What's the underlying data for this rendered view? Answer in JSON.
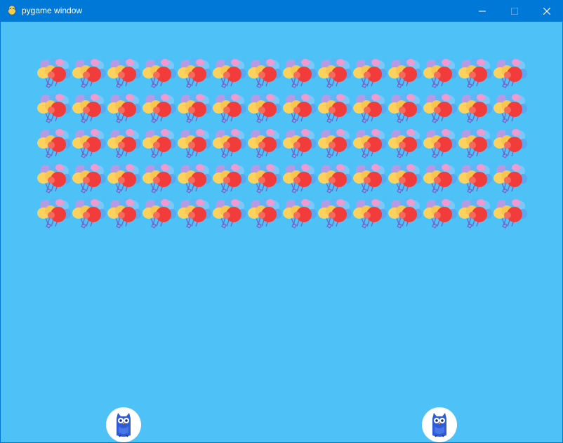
{
  "window": {
    "title": "pygame window",
    "app_icon": "pygame-snake-icon",
    "controls": [
      "minimize-icon",
      "maximize-icon",
      "close-icon"
    ]
  },
  "game": {
    "background_color": "#4ec1f7",
    "balloon_grid": {
      "rows": 5,
      "columns": 14,
      "sprite": "balloon-bunch-icon"
    },
    "players": [
      {
        "sprite": "owl-icon"
      },
      {
        "sprite": "owl-icon"
      }
    ]
  },
  "colors": {
    "titlebar": "#0078d7",
    "background": "#4ec1f7",
    "balloon_red": "#f23b3b",
    "balloon_yellow": "#fcd25e",
    "balloon_purple": "#b59ae6",
    "balloon_blue": "#62b4f5",
    "owl_blue": "#2f5bd6"
  }
}
